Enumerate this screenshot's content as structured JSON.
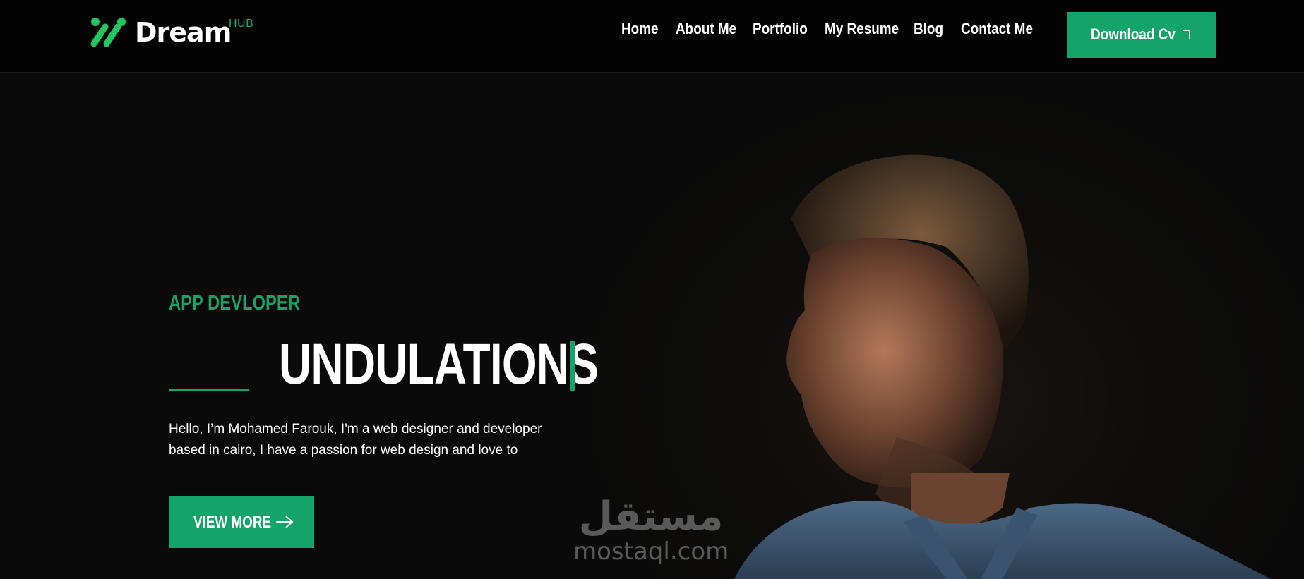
{
  "brand": {
    "name": "Dream",
    "superscript": "HUB",
    "accent": "#14a369"
  },
  "nav": {
    "items": [
      {
        "label": "Home"
      },
      {
        "label": "About Me"
      },
      {
        "label": "Portfolio"
      },
      {
        "label": "My Resume"
      },
      {
        "label": "Blog"
      },
      {
        "label": "Contact Me"
      }
    ],
    "download_label": "Download Cv",
    "download_icon": "document-icon"
  },
  "hero": {
    "subtitle": "APP DEVLOPER",
    "headline": "UNDULATIONS",
    "intro_line1": "Hello, I’m Mohamed Farouk, I'm a web designer and developer",
    "intro_line2": "based in cairo, I have a passion for web design and love to",
    "cta_label": "VIEW MORE",
    "cta_icon": "arrow-right-icon"
  },
  "watermark": {
    "arabic": "مستقل",
    "latin": "mostaql.com"
  }
}
